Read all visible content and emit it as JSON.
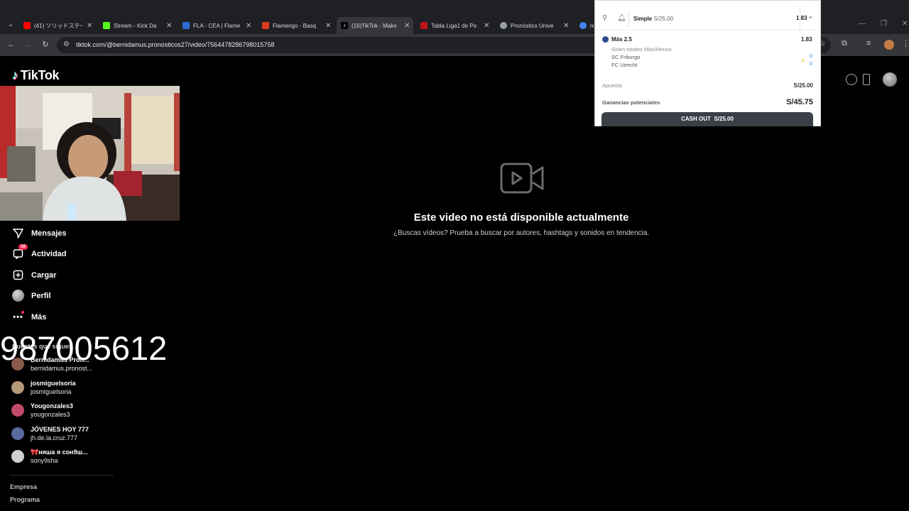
{
  "browser": {
    "tabs": [
      {
        "title": "(41) ソリッドステート",
        "color": "#ff0000"
      },
      {
        "title": "Stream - Kick Da",
        "color": "#53fc18"
      },
      {
        "title": "FLA - CEA | Flame",
        "color": "#2b6bd6"
      },
      {
        "title": "Flamengo - Basq",
        "color": "#e03b24"
      },
      {
        "title": "(16)TikTok - Make",
        "color": "#000000"
      },
      {
        "title": "Tabla Liga1 de Pe",
        "color": "#c0141b"
      },
      {
        "title": "Pronóstico Unive",
        "color": "#9aa0a6"
      },
      {
        "title": "re",
        "color": "#4285f4"
      }
    ],
    "url": "tiktok.com/@bernidamus.pronosticos27/video/7564478286798015758"
  },
  "tiktok": {
    "brand": "TikTok",
    "nav": [
      {
        "label": "Mensajes",
        "icon": "send-icon"
      },
      {
        "label": "Actividad",
        "icon": "inbox-icon",
        "badge": "16"
      },
      {
        "label": "Cargar",
        "icon": "upload-icon"
      },
      {
        "label": "Perfil",
        "icon": "avatar-icon"
      },
      {
        "label": "Más",
        "icon": "more-icon"
      }
    ],
    "phone_overlay": "987005612",
    "following_title": "Cuentas que sigues",
    "accounts": [
      {
        "name": "Bernidamus Pron...",
        "handle": "bernidamus.pronost...",
        "color": "#8a5a4a"
      },
      {
        "name": "josmiguelsoria",
        "handle": "josmiguelsoria",
        "color": "#b59a7a"
      },
      {
        "name": "Yougonzales3",
        "handle": "yougonzales3",
        "color": "#c04a6a"
      },
      {
        "name": "JÓVENES HOY 777",
        "handle": "jh.de.la.cruz.777",
        "color": "#5a6aa0"
      },
      {
        "name": "🎀няша я сон9ш...",
        "handle": "sony9sha",
        "color": "#d0d0d0"
      }
    ],
    "footer": [
      "Empresa",
      "Programa"
    ],
    "unavailable_title": "Este video no está disponible actualmente",
    "unavailable_sub": "¿Buscas vídeos? Prueba a buscar por autores, hashtags y sonidos en tendencia."
  },
  "betslip": {
    "type": "Simple",
    "stake_header": "S/25.00",
    "odds": "1.83",
    "market": "Más 2.5",
    "market_odds": "1.83",
    "market_type": "Goles totales Más/Menos",
    "home": "SC Friburgo",
    "away": "FC Utrecht",
    "home_score": "0",
    "away_score": "0",
    "stake_label": "Apuesta",
    "stake_value": "S/25.00",
    "potential_label": "Ganancias potenciales",
    "potential_value": "S/45.75",
    "cashout_label": "CASH OUT",
    "cashout_value": "S/25.00"
  }
}
